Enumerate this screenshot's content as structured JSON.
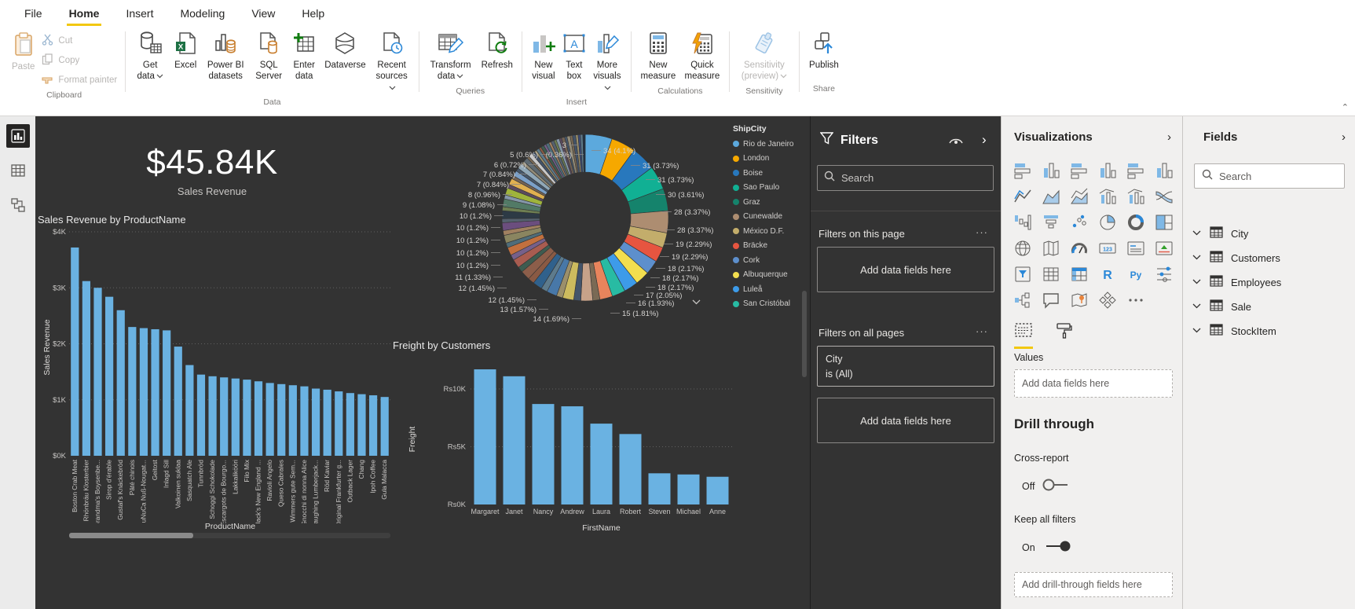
{
  "ribbon": {
    "menu": [
      "File",
      "Home",
      "Insert",
      "Modeling",
      "View",
      "Help"
    ],
    "active_tab": "Home",
    "accent_color": "#F2C811",
    "clipboard": {
      "label": "Clipboard",
      "paste": "Paste",
      "cut": "Cut",
      "copy": "Copy",
      "format_painter": "Format painter"
    },
    "data_group": {
      "label": "Data",
      "get_data": "Get data",
      "excel": "Excel",
      "pbi_datasets": "Power BI datasets",
      "sql_server": "SQL Server",
      "enter_data": "Enter data",
      "dataverse": "Dataverse",
      "recent_sources": "Recent sources"
    },
    "queries": {
      "label": "Queries",
      "transform_data": "Transform data",
      "refresh": "Refresh"
    },
    "insert_group": {
      "label": "Insert",
      "new_visual": "New visual",
      "text_box": "Text box",
      "more_visuals": "More visuals"
    },
    "calculations": {
      "label": "Calculations",
      "new_measure": "New measure",
      "quick_measure": "Quick measure"
    },
    "sensitivity": {
      "label": "Sensitivity",
      "button": "Sensitivity (preview)"
    },
    "share": {
      "label": "Share",
      "publish": "Publish"
    }
  },
  "canvas": {
    "kpi": {
      "value": "$45.84K",
      "label": "Sales Revenue"
    }
  },
  "chart_data": [
    {
      "type": "donut",
      "legend_title": "ShipCity",
      "legend": [
        {
          "name": "Rio de Janeiro",
          "color": "#5CA9DD"
        },
        {
          "name": "London",
          "color": "#F6A800"
        },
        {
          "name": "Boise",
          "color": "#2878BD"
        },
        {
          "name": "Sao Paulo",
          "color": "#11B094"
        },
        {
          "name": "Graz",
          "color": "#15836C"
        },
        {
          "name": "Cunewalde",
          "color": "#AD8D71"
        },
        {
          "name": "México D.F.",
          "color": "#C3AD6B"
        },
        {
          "name": "Bräcke",
          "color": "#E65540"
        },
        {
          "name": "Cork",
          "color": "#5D8FCC"
        },
        {
          "name": "Albuquerque",
          "color": "#F2DE4F"
        },
        {
          "name": "Luleå",
          "color": "#3D9BE9"
        },
        {
          "name": "San Cristóbal",
          "color": "#28BBA3"
        }
      ],
      "callouts_right": [
        "34 (4.1%)",
        "31 (3.73%)",
        "31 (3.73%)",
        "30 (3.61%)",
        "28 (3.37%)",
        "28 (3.37%)",
        "19 (2.29%)",
        "19 (2.29%)",
        "18 (2.17%)",
        "18 (2.17%)",
        "18 (2.17%)",
        "17 (2.05%)",
        "16 (1.93%)",
        "15 (1.81%)"
      ],
      "callouts_left": [
        "3",
        "5 (0.6%)",
        "(0.36%)",
        "6 (0.72%)",
        "7 (0.84%)",
        "7 (0.84%)",
        "8 (0.96%)",
        "9 (1.08%)",
        "10 (1.2%)",
        "10 (1.2%)",
        "10 (1.2%)",
        "10 (1.2%)",
        "10 (1.2%)",
        "11 (1.33%)",
        "12 (1.45%)",
        "12 (1.45%)",
        "13 (1.57%)",
        "14 (1.69%)"
      ],
      "slices": [
        {
          "v": 34,
          "c": "#5CA9DD"
        },
        {
          "v": 31,
          "c": "#F6A800"
        },
        {
          "v": 31,
          "c": "#2878BD"
        },
        {
          "v": 30,
          "c": "#11B094"
        },
        {
          "v": 28,
          "c": "#15836C"
        },
        {
          "v": 28,
          "c": "#AD8D71"
        },
        {
          "v": 19,
          "c": "#C3AD6B"
        },
        {
          "v": 19,
          "c": "#E65540"
        },
        {
          "v": 18,
          "c": "#5D8FCC"
        },
        {
          "v": 18,
          "c": "#F2DE4F"
        },
        {
          "v": 18,
          "c": "#3D9BE9"
        },
        {
          "v": 17,
          "c": "#28BBA3"
        },
        {
          "v": 16,
          "c": "#E8845C"
        },
        {
          "v": 9
        },
        {
          "v": 15,
          "c": "#C7A289"
        },
        {
          "v": 9
        },
        {
          "v": 14,
          "c": "#CDBB5E"
        },
        {
          "v": 8
        },
        {
          "v": 13,
          "c": "#4878A8"
        },
        {
          "v": 8
        },
        {
          "v": 12,
          "c": "#30618C"
        },
        {
          "v": 8
        },
        {
          "v": 12,
          "c": "#8C5E4A"
        },
        {
          "v": 7
        },
        {
          "v": 11,
          "c": "#A85C50"
        },
        {
          "v": 7
        },
        {
          "v": 10,
          "c": "#C2703E"
        },
        {
          "v": 6
        },
        {
          "v": 10,
          "c": "#8A8560"
        },
        {
          "v": 6
        },
        {
          "v": 10,
          "c": "#6B4E7E"
        },
        {
          "v": 5
        },
        {
          "v": 10,
          "c": "#2D3A45"
        },
        {
          "v": 5
        },
        {
          "v": 10,
          "c": "#527A66"
        },
        {
          "v": 5
        },
        {
          "v": 9,
          "c": "#9FB43C"
        },
        {
          "v": 5
        },
        {
          "v": 8,
          "c": "#E0B050"
        },
        {
          "v": 4
        },
        {
          "v": 7,
          "c": "#7BA0C8"
        },
        {
          "v": 4
        },
        {
          "v": 7,
          "c": "#90A8B8"
        },
        {
          "v": 4
        },
        {
          "v": 6,
          "c": "#5E6A72"
        },
        {
          "v": 3
        },
        {
          "v": 5,
          "c": "#C8C8C8"
        },
        {
          "v": 4
        },
        {
          "v": 3
        },
        {
          "v": 4
        },
        {
          "v": 3
        },
        {
          "v": 4
        },
        {
          "v": 3
        },
        {
          "v": 4
        },
        {
          "v": 3
        },
        {
          "v": 4
        },
        {
          "v": 3
        },
        {
          "v": 4
        },
        {
          "v": 3
        },
        {
          "v": 4
        },
        {
          "v": 3
        },
        {
          "v": 4
        },
        {
          "v": 3
        },
        {
          "v": 4
        },
        {
          "v": 3
        },
        {
          "v": 3,
          "c": "#3C4C78"
        },
        {
          "v": 3
        },
        {
          "v": 3,
          "c": "#203040"
        }
      ]
    },
    {
      "type": "bar",
      "title": "Sales Revenue by ProductName",
      "xlabel": "ProductName",
      "ylabel": "Sales Revenue",
      "ylim": [
        0,
        4000
      ],
      "yticks": [
        "$0K",
        "$1K",
        "$2K",
        "$3K",
        "$4K"
      ],
      "bar_color": "#6AB2E2",
      "categories": [
        "Boston Crab Meat",
        "Rhönbräu Klosterbier",
        "Grandma's Boysenbe...",
        "Sirop d'érable",
        "Gustaf's Knäckebröd",
        "Pâté chinois",
        "NuNuCa Nuß-Nougat...",
        "Geitost",
        "Inlagd Sill",
        "Valkoinen suklaa",
        "Sasquatch Ale",
        "Tunnbröd",
        "Schoggi Schokolade",
        "Escargots de Bourgo...",
        "Lakkalikööri",
        "Filo Mix",
        "Jack's New England ...",
        "Ravioli Angelo",
        "Queso Cabrales",
        "Wimmers gute Sem...",
        "Gnocchi di nonna Alice",
        "Laughing Lumberjack...",
        "Röd Kaviar",
        "Original Frankfurter g...",
        "Outback Lager",
        "Chang",
        "Ipoh Coffee",
        "Gula Malacca"
      ],
      "values_k": [
        3.72,
        3.12,
        3.0,
        2.84,
        2.6,
        2.3,
        2.28,
        2.26,
        2.24,
        1.95,
        1.62,
        1.45,
        1.42,
        1.4,
        1.38,
        1.36,
        1.33,
        1.3,
        1.28,
        1.26,
        1.24,
        1.2,
        1.18,
        1.15,
        1.12,
        1.1,
        1.08,
        1.05
      ]
    },
    {
      "type": "bar",
      "title": "Freight by Customers",
      "xlabel": "FirstName",
      "ylabel": "Freight",
      "ylim": [
        0,
        12000
      ],
      "yticks": [
        "Rs0K",
        "Rs5K",
        "Rs10K"
      ],
      "bar_color": "#6AB2E2",
      "categories": [
        "Margaret",
        "Janet",
        "Nancy",
        "Andrew",
        "Laura",
        "Robert",
        "Steven",
        "Michael",
        "Anne"
      ],
      "values_k": [
        11.7,
        11.1,
        8.7,
        8.5,
        7.0,
        6.1,
        2.7,
        2.6,
        2.4
      ]
    }
  ],
  "filters_pane": {
    "title": "Filters",
    "search_placeholder": "Search",
    "page_section_label": "Filters on this page",
    "all_section_label": "Filters on all pages",
    "placeholder": "Add data fields here",
    "city_filter": {
      "field": "City",
      "condition": "is (All)"
    }
  },
  "visualizations_pane": {
    "title": "Visualizations",
    "visuals": [
      "stacked-bar-chart",
      "stacked-column-chart",
      "clustered-bar-chart",
      "clustered-column-chart",
      "100-stacked-bar-chart",
      "100-stacked-column-chart",
      "line-chart",
      "area-chart",
      "stacked-area-chart",
      "line-and-stacked-column-chart",
      "line-and-clustered-column-chart",
      "ribbon-chart",
      "waterfall-chart",
      "funnel-chart",
      "scatter-chart",
      "pie-chart",
      "donut-chart",
      "treemap",
      "map",
      "filled-map",
      "gauge",
      "card",
      "multi-row-card",
      "kpi",
      "slicer",
      "table",
      "matrix",
      "r-script-visual",
      "python-visual",
      "key-influencers",
      "decomposition-tree",
      "q-and-a",
      "arcgis-map",
      "paginated-report",
      "more-options"
    ],
    "values_label": "Values",
    "values_placeholder": "Add data fields here",
    "drill": {
      "heading": "Drill through",
      "cross_report_label": "Cross-report",
      "cross_report_state": "Off",
      "keep_filters_label": "Keep all filters",
      "keep_filters_state": "On",
      "placeholder": "Add drill-through fields here"
    }
  },
  "fields_pane": {
    "title": "Fields",
    "search_placeholder": "Search",
    "tables": [
      "City",
      "Customers",
      "Employees",
      "Sale",
      "StockItem"
    ]
  }
}
